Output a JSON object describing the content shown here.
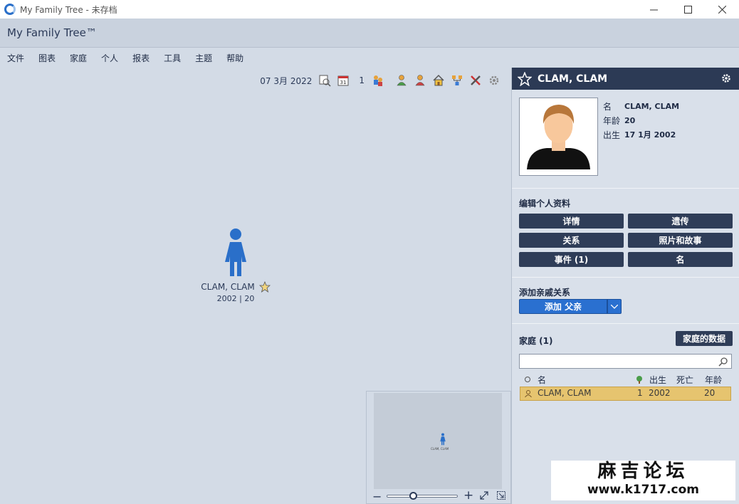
{
  "window": {
    "title": "My Family Tree - 未存档"
  },
  "header": {
    "brand": "My Family Tree™"
  },
  "menu": {
    "items": [
      "文件",
      "图表",
      "家庭",
      "个人",
      "报表",
      "工具",
      "主题",
      "帮助"
    ]
  },
  "toolbar": {
    "date": "07 3月 2022",
    "count": "1",
    "calendar_day": "31"
  },
  "tree": {
    "name": "CLAM, CLAM",
    "info": "2002 | 20",
    "mini_name": "CLAM, CLAM"
  },
  "panel": {
    "name": "CLAM, CLAM",
    "facts": [
      {
        "label": "名",
        "value": "CLAM, CLAM"
      },
      {
        "label": "年龄",
        "value": "20"
      },
      {
        "label": "出生",
        "value": "17 1月 2002"
      }
    ],
    "edit_title": "编辑个人资料",
    "buttons": [
      "详情",
      "遗传",
      "关系",
      "照片和故事",
      "事件 (1)",
      "名"
    ],
    "add_title": "添加亲戚关系",
    "add_button": "添加 父亲",
    "family_title": "家庭 (1)",
    "family_data_button": "家庭的数据",
    "search_placeholder": "",
    "columns": {
      "name": "名",
      "birth": "出生",
      "death": "死亡",
      "age": "年龄"
    },
    "row": {
      "name": "CLAM, CLAM",
      "tree": "1",
      "birth": "2002",
      "death": "",
      "age": "20"
    }
  },
  "watermark": {
    "line1": "麻吉论坛",
    "line2": "www.k1717.com"
  },
  "colors": {
    "accent": "#2a70d0",
    "panel_head": "#2c3a55",
    "row_highlight": "#e6c46f"
  }
}
